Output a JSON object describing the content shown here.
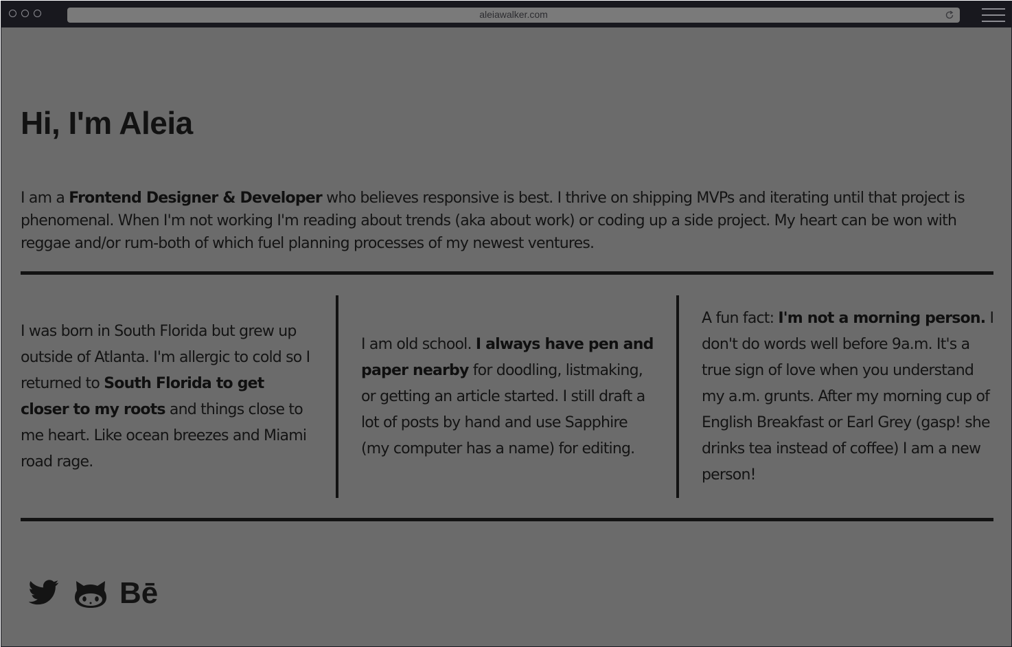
{
  "browser": {
    "url": "aleiawalker.com"
  },
  "page": {
    "title": "Hi, I'm Aleia",
    "intro": {
      "before_bold": "I am a ",
      "bold": "Frontend Designer & Developer",
      "after_bold": " who believes responsive is best. I thrive on shipping MVPs and iterating until that project is phenomenal. When I'm not working I'm reading about trends (aka about work) or coding up a side project. My heart can be won with reggae and/or rum-both of which fuel planning processes of my newest ventures."
    },
    "columns": [
      {
        "before_bold": "I was born in South Florida but grew up outside of Atlanta. I'm allergic to cold so I returned to ",
        "bold": "South Florida to get closer to my roots",
        "after_bold": " and things close to me heart. Like ocean breezes and Miami road rage."
      },
      {
        "before_bold": "I am old school. ",
        "bold": "I always have pen and paper nearby",
        "after_bold": " for doodling, listmaking, or getting an article started. I still draft a lot of posts by hand and use Sapphire (my computer has a name) for editing."
      },
      {
        "before_bold": "A fun fact: ",
        "bold": "I'm not a morning person.",
        "after_bold": " I don't do words well before 9a.m. It's a true sign of love when you understand my a.m. grunts. After my morning cup of English Breakfast or Earl Grey (gasp! she drinks tea instead of coffee) I am a new person!"
      }
    ],
    "socials": [
      {
        "icon": "twitter-icon"
      },
      {
        "icon": "github-icon"
      },
      {
        "icon": "behance-icon",
        "text": "Bē"
      }
    ]
  },
  "colors": {
    "chrome": "#18181e",
    "page_background": "#6b6b6b",
    "text": "#141414",
    "rule": "#121212"
  }
}
